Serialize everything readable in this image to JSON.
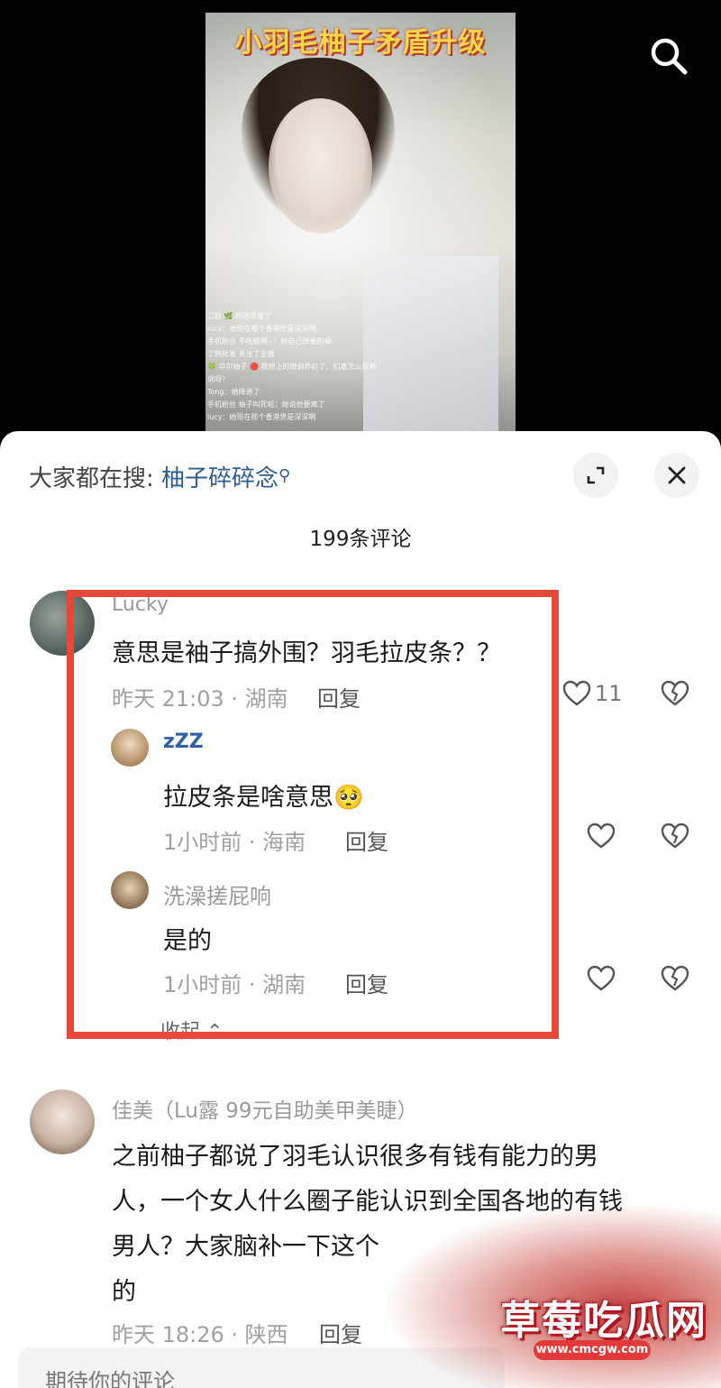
{
  "video": {
    "title": "小羽毛柚子矛盾升级",
    "live_chat": [
      "二妖 🌿  韩国录播了",
      "lucy：她现在哪个香港男是深深啊",
      "手机粉丝  不吃醋啊~！她自己想要的😂",
      "了韩批发 关注了主播",
      "🍀 华尔柚子 🔴  我想上的微调养好了，们塞怎么保养",
      "说呀？",
      "Tong：她降退了",
      "手机粉丝  柚子叫死啦：她说他要离了",
      "lucy：她现在那个香港男是深深啊"
    ]
  },
  "sheet": {
    "search_label": "大家都在搜:",
    "search_keyword": "柚子碎碎念",
    "comment_count": "199条评论"
  },
  "comments": [
    {
      "user": "Lucky",
      "text": "意思是袖子搞外围？羽毛拉皮条？？",
      "time_location": "昨天 21:03 · 湖南",
      "reply": "回复",
      "likes": "11"
    },
    {
      "user": "zZZ",
      "text": "拉皮条是啥意思🥺",
      "time_location": "1小时前 · 海南",
      "reply": "回复"
    },
    {
      "user": "洗澡搓屁响",
      "text": "是的",
      "time_location": "1小时前 · 湖南",
      "reply": "回复"
    },
    {
      "user": "佳美（Lu露 99元自助美甲美睫）",
      "text_lines": [
        "之前柚子都说了羽毛认识很多有钱有能力的男",
        "人，一个女人什么圈子能认识到全国各地的有钱",
        "男人？大家脑补一下这个",
        "的"
      ],
      "time_location": "昨天 18:26 · 陕西",
      "reply": "回复"
    }
  ],
  "collapse": "收起 ⌃",
  "input": {
    "placeholder": "期待你的评论"
  },
  "watermark": {
    "text": "草莓吃瓜网",
    "url": "www.cmcgw.com"
  },
  "colors": {
    "highlight": "#e8483a",
    "keyword": "#2c5d8e",
    "video_title": "#f6d64a"
  }
}
